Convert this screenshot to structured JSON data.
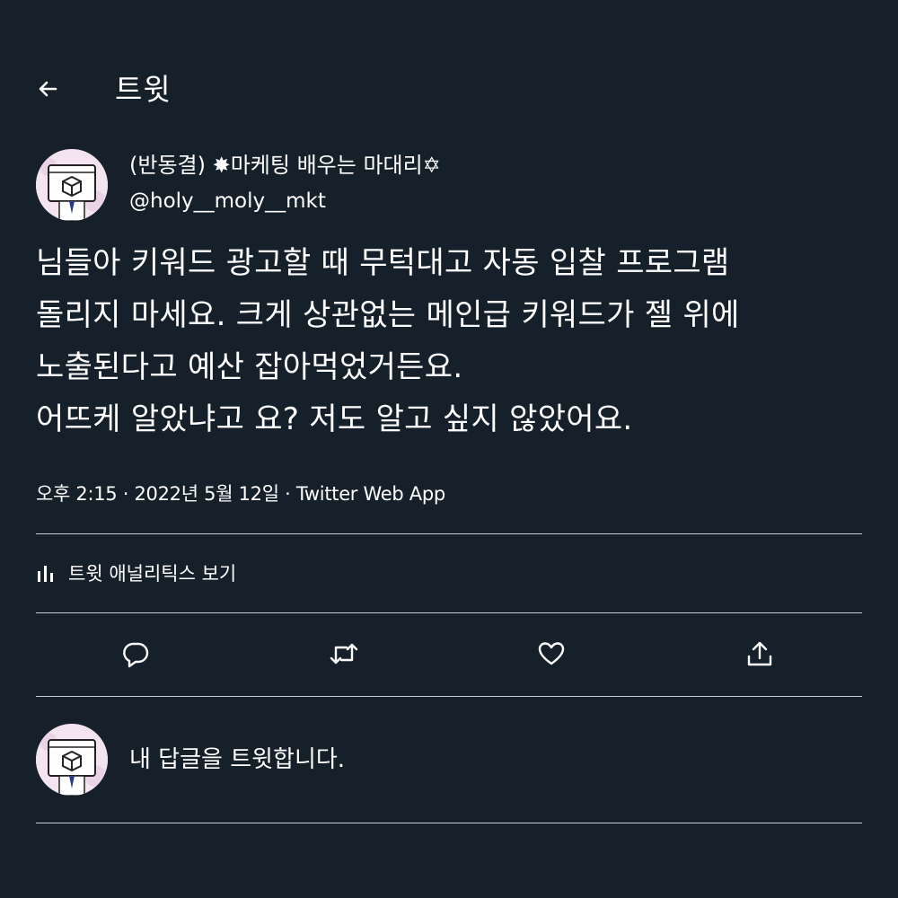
{
  "header": {
    "title": "트윗",
    "back_icon": "back-arrow-icon"
  },
  "author": {
    "name": "(반동결) ✸마케팅 배우는 마대리✡",
    "handle": "@holy__moly__mkt"
  },
  "tweet": {
    "lines": [
      "님들아 키워드 광고할 때 무턱대고 자동 입찰 프로그램",
      "돌리지 마세요. 크게 상관없는 메인급 키워드가 젤 위에",
      "노출된다고 예산 잡아먹었거든요.",
      "어뜨케 알았냐고 요? 저도 알고 싶지 않았어요."
    ],
    "meta": "오후 2:15 · 2022년 5월 12일 · Twitter Web App"
  },
  "analytics": {
    "label": "트윗 애널리틱스 보기",
    "icon": "bar-chart-icon"
  },
  "actions": {
    "reply_icon": "reply-icon",
    "retweet_icon": "retweet-icon",
    "like_icon": "heart-icon",
    "share_icon": "share-icon"
  },
  "reply_box": {
    "placeholder": "내 답글을 트윗합니다."
  },
  "colors": {
    "background": "#15202b",
    "text": "#ffffff",
    "divider": "#c7ccd1"
  }
}
